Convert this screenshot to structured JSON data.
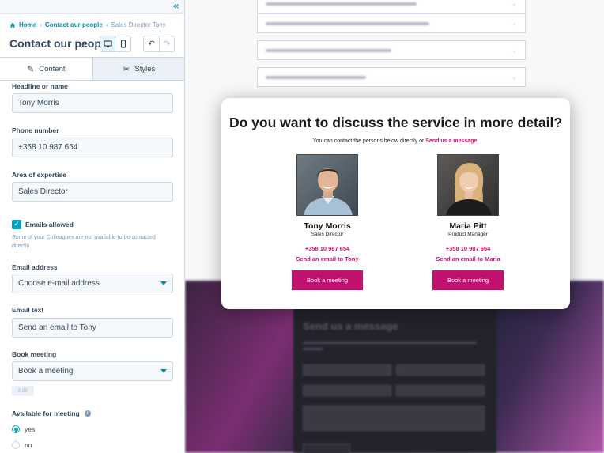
{
  "panel": {
    "breadcrumb": [
      {
        "label": "Home",
        "link": true
      },
      {
        "label": "Contact our people",
        "link": true
      },
      {
        "label": "Sales Director Tony",
        "link": false
      }
    ],
    "title": "Contact our people",
    "tabs": [
      {
        "label": "Content",
        "icon": "pencil-icon",
        "active": true
      },
      {
        "label": "Styles",
        "icon": "brush-icon",
        "active": false
      }
    ],
    "fields": {
      "headline_label": "Headline or name",
      "headline_value": "Tony Morris",
      "phone_label": "Phone number",
      "phone_value": "+358 10 987 654",
      "expertise_label": "Area of expertise",
      "expertise_value": "Sales Director",
      "emails_allowed_label": "Emails allowed",
      "emails_allowed_checked": true,
      "emails_help": "Some of your Colleagues are not available to be contacted directly",
      "email_address_label": "Email address",
      "email_address_value": "Choose e-mail address",
      "email_text_label": "Email text",
      "email_text_value": "Send an email to Tony",
      "book_meeting_label": "Book meeting",
      "book_meeting_value": "Book a meeting",
      "edit_label": "Edit",
      "available_label": "Available for meeting",
      "radio_yes": "yes",
      "radio_no": "no",
      "available_selected": "yes"
    }
  },
  "modal": {
    "title": "Do you want to discuss the service in more detail?",
    "subtitle_prefix": "You can contact the persons below directly or ",
    "subtitle_link": "Send us a message",
    "subtitle_suffix": ".",
    "people": [
      {
        "name": "Tony Morris",
        "role": "Sales Director",
        "phone": "+358 10 987 654",
        "email_text": "Send an email to Tony",
        "button": "Book a meeting"
      },
      {
        "name": "Maria Pitt",
        "role": "Product Manager",
        "phone": "+358 10 987 654",
        "email_text": "Send an email to Maria",
        "button": "Book a meeting"
      }
    ]
  },
  "background": {
    "form_title": "Send us a message"
  },
  "colors": {
    "accent": "#c2106e",
    "hubspot_teal": "#00a4bd",
    "text": "#33475b"
  }
}
